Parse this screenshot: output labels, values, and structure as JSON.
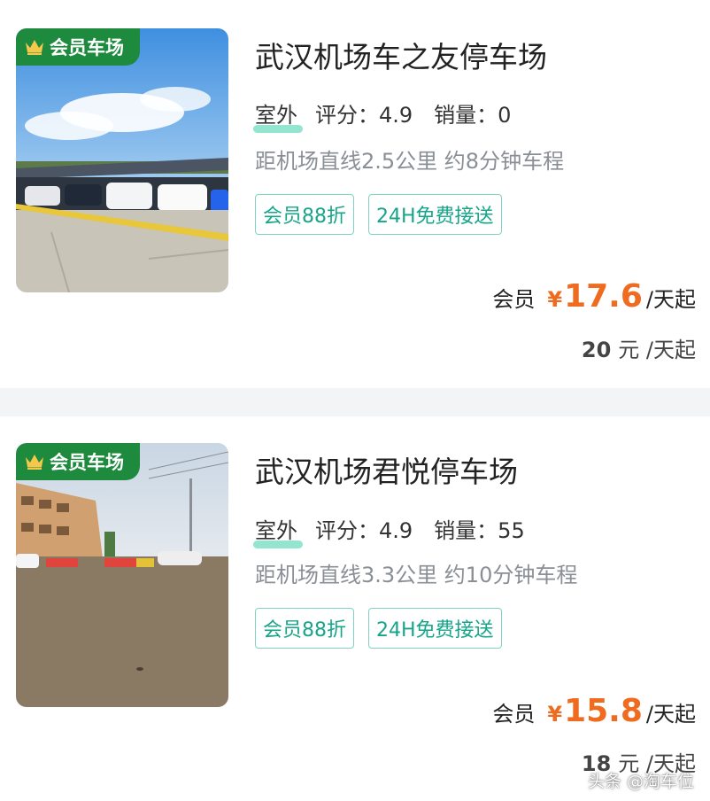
{
  "listings": [
    {
      "badge": "会员车场",
      "name": "武汉机场车之友停车场",
      "type": "室外",
      "rating_label": "评分：4.9",
      "sales_label": "销量：0",
      "distance": "距机场直线2.5公里 约8分钟车程",
      "tags": [
        "会员88折",
        "24H免费接送"
      ],
      "member_label": "会员",
      "member_currency": "¥",
      "member_price": "17.6",
      "member_unit": "/天起",
      "normal_price": "20",
      "normal_unit": "元 /天起"
    },
    {
      "badge": "会员车场",
      "name": "武汉机场君悦停车场",
      "type": "室外",
      "rating_label": "评分：4.9",
      "sales_label": "销量：55",
      "distance": "距机场直线3.3公里 约10分钟车程",
      "tags": [
        "会员88折",
        "24H免费接送"
      ],
      "member_label": "会员",
      "member_currency": "¥",
      "member_price": "15.8",
      "member_unit": "/天起",
      "normal_price": "18",
      "normal_unit": "元 /天起"
    }
  ],
  "watermark": "头条 @淘车位",
  "colors": {
    "badge_green": "#1e8a3e",
    "tag_teal": "#17a58a",
    "price_orange": "#ef6b1f"
  },
  "icons": {
    "badge": "crown-icon"
  }
}
